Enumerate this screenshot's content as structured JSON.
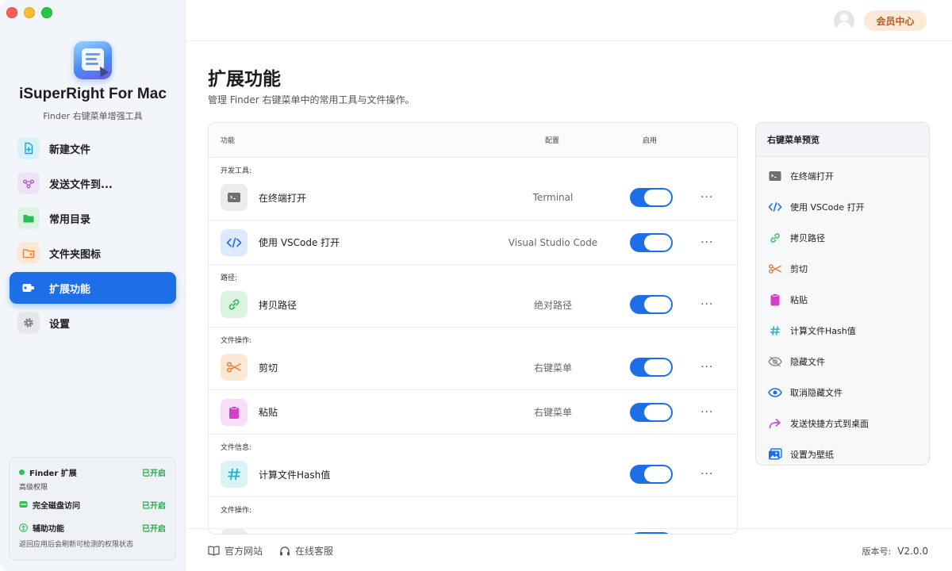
{
  "app": {
    "name": "iSuperRight For Mac",
    "subtitle": "Finder 右键菜单增强工具"
  },
  "sidebar": {
    "items": [
      {
        "label": "新建文件",
        "icon": "new-file-icon",
        "active": false
      },
      {
        "label": "发送文件到...",
        "icon": "share-nodes-icon",
        "active": false
      },
      {
        "label": "常用目录",
        "icon": "folder-icon",
        "active": false
      },
      {
        "label": "文件夹图标",
        "icon": "folder-image-icon",
        "active": false
      },
      {
        "label": "扩展功能",
        "icon": "extension-icon",
        "active": true
      },
      {
        "label": "设置",
        "icon": "gear-icon",
        "active": false
      }
    ]
  },
  "permissions": {
    "finder_label": "Finder 扩展",
    "finder_status": "已开启",
    "advanced_label": "高级权限",
    "disk_label": "完全磁盘访问",
    "disk_status": "已开启",
    "access_label": "辅助功能",
    "access_status": "已开启",
    "note": "返回应用后会刷新可检测的权限状态"
  },
  "header": {
    "vip_label": "会员中心"
  },
  "page": {
    "title": "扩展功能",
    "subtitle": "管理 Finder 右键菜单中的常用工具与文件操作。"
  },
  "table": {
    "col_feature": "功能",
    "col_config": "配置",
    "col_enabled": "启用",
    "groups": [
      {
        "title": "开发工具:",
        "rows": [
          {
            "label": "在终端打开",
            "config": "Terminal",
            "icon": "terminal-icon",
            "enabled": true
          },
          {
            "label": "使用 VSCode 打开",
            "config": "Visual Studio Code",
            "icon": "code-icon",
            "enabled": true
          }
        ]
      },
      {
        "title": "路径:",
        "rows": [
          {
            "label": "拷贝路径",
            "config": "绝对路径",
            "icon": "link-icon",
            "enabled": true
          }
        ]
      },
      {
        "title": "文件操作:",
        "rows": [
          {
            "label": "剪切",
            "config": "右键菜单",
            "icon": "scissors-icon",
            "enabled": true
          },
          {
            "label": "粘贴",
            "config": "右键菜单",
            "icon": "clipboard-icon",
            "enabled": true
          }
        ]
      },
      {
        "title": "文件信息:",
        "rows": [
          {
            "label": "计算文件Hash值",
            "config": "",
            "icon": "hash-icon",
            "enabled": true
          }
        ]
      },
      {
        "title": "文件操作:",
        "rows": []
      }
    ],
    "more_label": "···"
  },
  "preview": {
    "title": "右键菜单预览",
    "items": [
      {
        "label": "在终端打开",
        "icon": "terminal-icon"
      },
      {
        "label": "使用 VSCode 打开",
        "icon": "code-icon"
      },
      {
        "label": "拷贝路径",
        "icon": "link-icon"
      },
      {
        "label": "剪切",
        "icon": "scissors-icon"
      },
      {
        "label": "粘贴",
        "icon": "clipboard-icon"
      },
      {
        "label": "计算文件Hash值",
        "icon": "hash-icon"
      },
      {
        "label": "隐藏文件",
        "icon": "eye-slash-icon"
      },
      {
        "label": "取消隐藏文件",
        "icon": "eye-icon"
      },
      {
        "label": "发送快捷方式到桌面",
        "icon": "share-arrow-icon"
      },
      {
        "label": "设置为壁纸",
        "icon": "wallpaper-icon"
      }
    ]
  },
  "footer": {
    "website": "官方网站",
    "support": "在线客服",
    "version_label": "版本号:",
    "version": "V2.0.0"
  },
  "colors": {
    "accent": "#1d6fe8",
    "success": "#2aa84a",
    "vip_bg": "#fde9d8",
    "vip_text": "#b85c1f"
  }
}
